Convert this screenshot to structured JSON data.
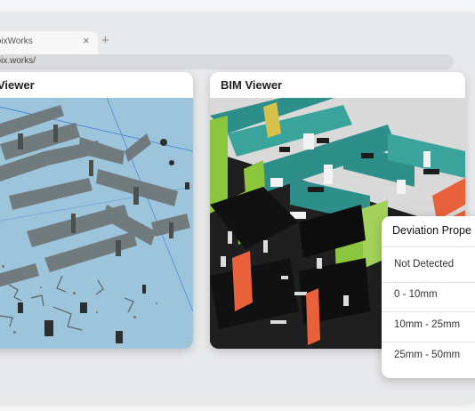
{
  "browser": {
    "tab_title": "CupixWorks",
    "close_glyph": "×",
    "new_tab_glyph": "+",
    "url": "cupix.works/"
  },
  "viewers": {
    "left_title": "Viewer",
    "right_title": "BIM Viewer"
  },
  "deviation_panel": {
    "title": "Deviation Prope",
    "items": [
      "Not Detected",
      "0 - 10mm",
      "10mm - 25mm",
      "25mm - 50mm"
    ]
  },
  "colors": {
    "pointcloud_bg": "#9cc4da",
    "bim_bg": "#1a1a1a",
    "bim_teal": "#2e8f8a",
    "bim_green": "#8cc63f",
    "bim_orange": "#e8613a",
    "bim_yellow": "#d6c14a"
  }
}
